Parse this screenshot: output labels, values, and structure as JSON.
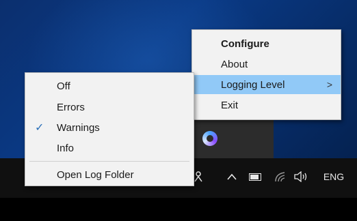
{
  "main_menu": {
    "items": [
      {
        "label": "Configure"
      },
      {
        "label": "About"
      },
      {
        "label": "Logging Level",
        "arrow": ">"
      },
      {
        "label": "Exit"
      }
    ]
  },
  "logging_submenu": {
    "items": [
      {
        "label": "Off"
      },
      {
        "label": "Errors"
      },
      {
        "label": "Warnings",
        "check": "✓"
      },
      {
        "label": "Info"
      },
      {
        "label": "Open Log Folder"
      }
    ],
    "selected": "Warnings"
  },
  "taskbar": {
    "language": "ENG",
    "icons": [
      "people-icon",
      "chevron-up-icon",
      "battery-icon",
      "wifi-icon",
      "volume-icon"
    ]
  },
  "colors": {
    "highlight": "#91c9f7",
    "menu_bg": "#f2f2f2",
    "taskbar": "#101010",
    "desktop": "#0a3a86"
  }
}
